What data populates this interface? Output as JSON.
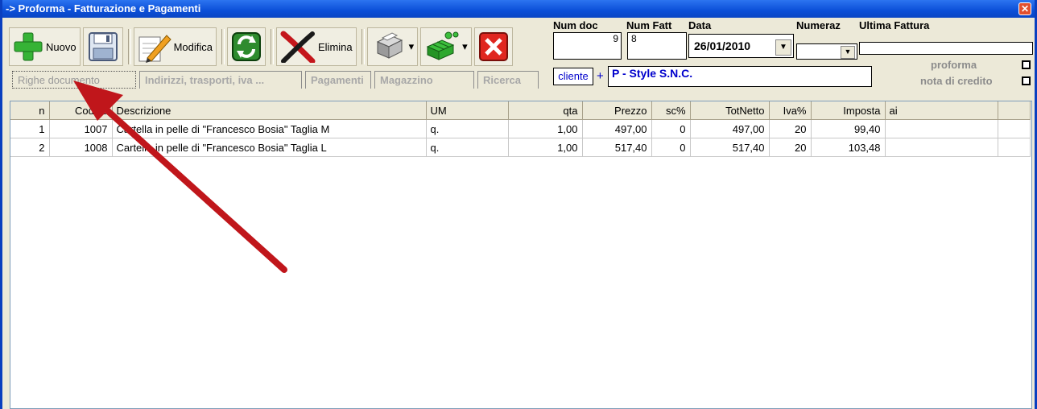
{
  "window": {
    "title": "-> Proforma - Fatturazione e Pagamenti",
    "close_label": "✕"
  },
  "toolbar": {
    "nuovo_label": "Nuovo",
    "modifica_label": "Modifica",
    "elimina_label": "Elimina",
    "icons": [
      "plus-icon",
      "save-icon",
      "edit-pencil-icon",
      "refresh-icon",
      "delete-x-icon",
      "print-icon",
      "grid-icon",
      "close-icon"
    ]
  },
  "header": {
    "num_doc_label": "Num doc",
    "num_doc_value": "9",
    "num_fatt_label": "Num Fatt",
    "num_fatt_value": "8",
    "data_label": "Data",
    "data_value": "26/01/2010",
    "numeraz_label": "Numeraz",
    "numeraz_value": "",
    "ultima_fattura_label": "Ultima Fattura",
    "ultima_fattura_value": "",
    "cliente_button": "cliente",
    "plus": "+",
    "cliente_value": "P - Style S.N.C.",
    "proforma_label": "proforma",
    "nota_credito_label": "nota di credito"
  },
  "tabs": [
    "Righe documento",
    "Indirizzi, trasporti, iva ...",
    "Pagamenti",
    "Magazzino",
    "Ricerca"
  ],
  "grid": {
    "columns": [
      "n",
      "Codice",
      "Descrizione",
      "UM",
      "qta",
      "Prezzo",
      "sc%",
      "TotNetto",
      "Iva%",
      "Imposta",
      "ai"
    ],
    "rows": [
      [
        "1",
        "1007",
        "Cartella in pelle di \"Francesco Bosia\" Taglia M",
        "q.",
        "1,00",
        "497,00",
        "0",
        "497,00",
        "20",
        "99,40",
        ""
      ],
      [
        "2",
        "1008",
        "Cartella in pelle di \"Francesco Bosia\"  Taglia L",
        "q.",
        "1,00",
        "517,40",
        "0",
        "517,40",
        "20",
        "103,48",
        ""
      ]
    ]
  },
  "colors": {
    "titlebar": "#0b4fd8",
    "arrow": "#c0161b",
    "cliente_text": "#0000cc"
  }
}
